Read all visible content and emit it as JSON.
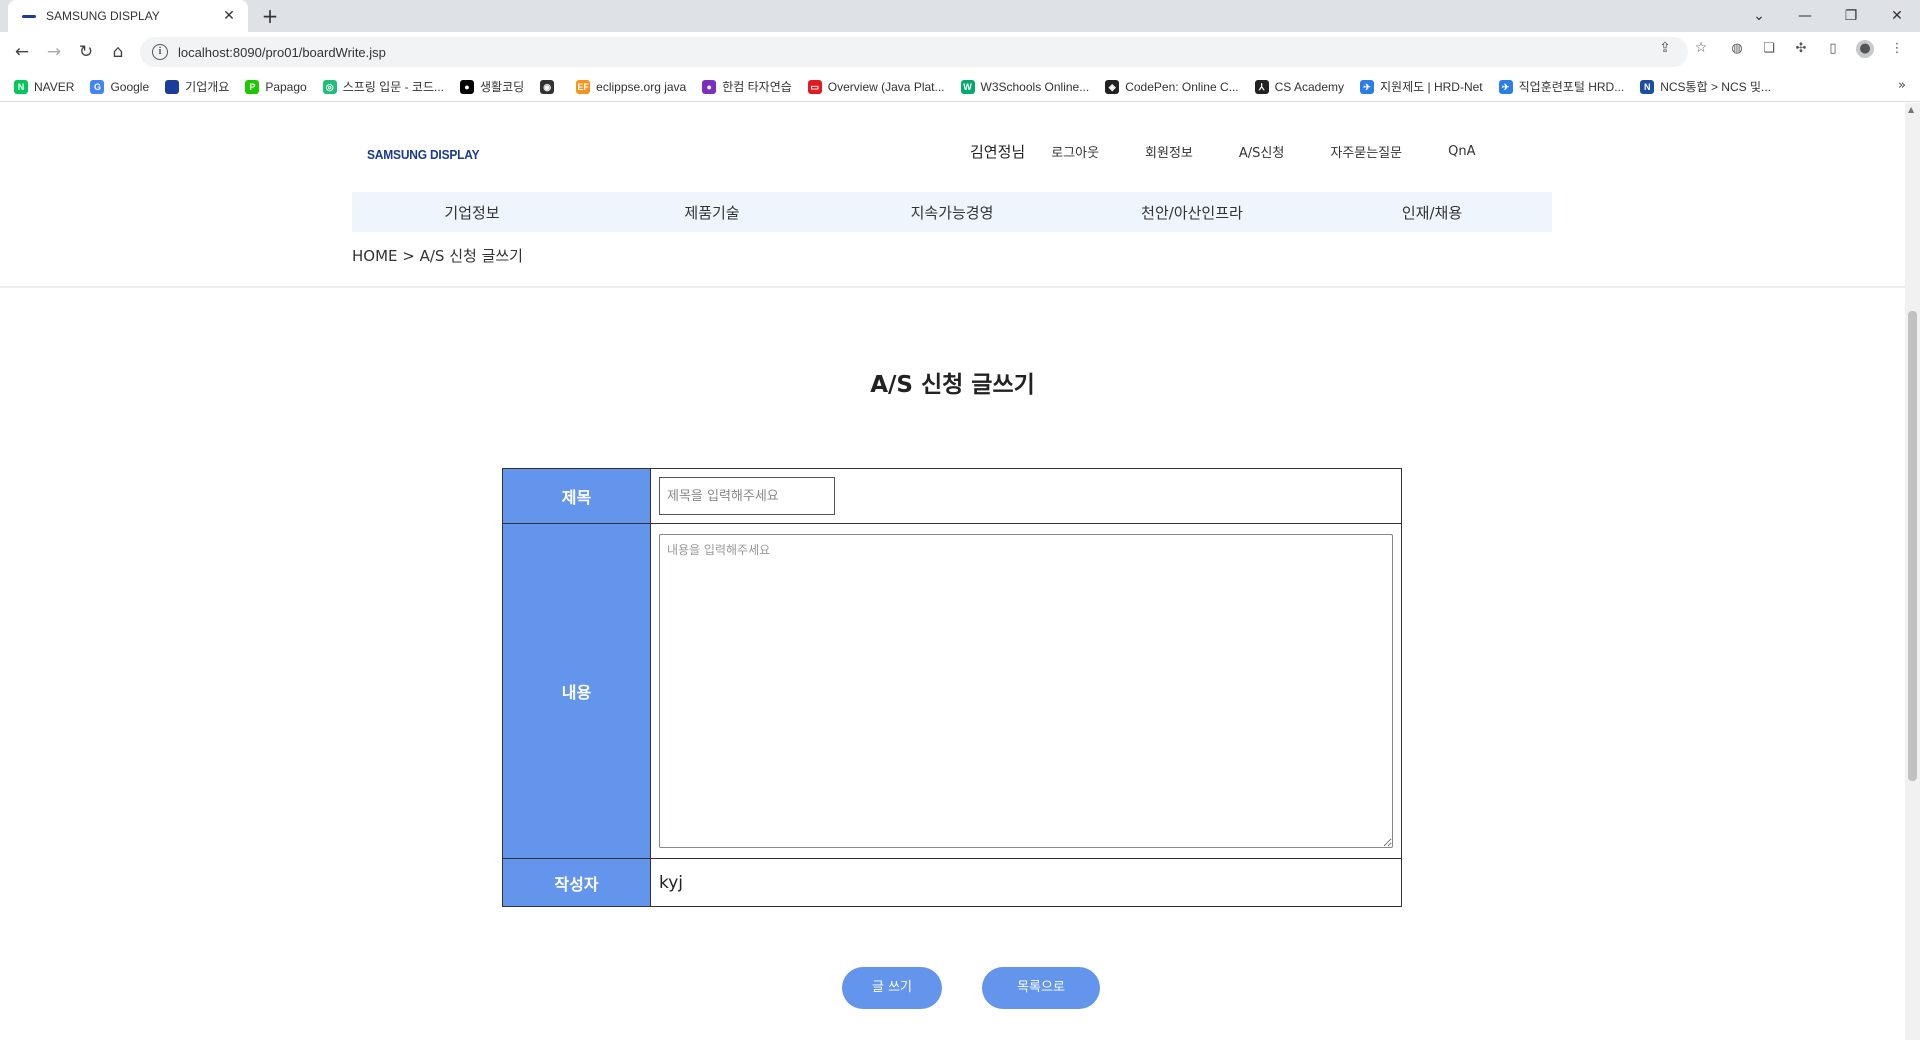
{
  "browser": {
    "tab_title": "SAMSUNG DISPLAY",
    "url": "localhost:8090/pro01/boardWrite.jsp",
    "bookmarks": [
      {
        "label": "NAVER",
        "icon": "naver-icon",
        "color": "#03c75a",
        "glyph": "N"
      },
      {
        "label": "Google",
        "icon": "google-icon",
        "color": "#4285f4",
        "glyph": "G"
      },
      {
        "label": "기업개요",
        "icon": "samsung-icon",
        "color": "#1c3c9b",
        "glyph": ""
      },
      {
        "label": "Papago",
        "icon": "papago-icon",
        "color": "#1ec800",
        "glyph": "P"
      },
      {
        "label": "스프링 입문 - 코드...",
        "icon": "inflearn-icon",
        "color": "#1dc078",
        "glyph": "◎"
      },
      {
        "label": "생활코딩",
        "icon": "opentutorials-icon",
        "color": "#000000",
        "glyph": "●"
      },
      {
        "label": "",
        "icon": "globe-icon",
        "color": "#333333",
        "glyph": "◉"
      },
      {
        "label": "eclippse.org java",
        "icon": "eclipse-icon",
        "color": "#f7941e",
        "glyph": "EF"
      },
      {
        "label": "한컴 타자연습",
        "icon": "hancom-icon",
        "color": "#7b2fbe",
        "glyph": "●"
      },
      {
        "label": "Overview (Java Plat...",
        "icon": "oracle-icon",
        "color": "#e11b22",
        "glyph": "▭"
      },
      {
        "label": "W3Schools Online...",
        "icon": "w3schools-icon",
        "color": "#04aa6d",
        "glyph": "W"
      },
      {
        "label": "CodePen: Online C...",
        "icon": "codepen-icon",
        "color": "#222222",
        "glyph": "◈"
      },
      {
        "label": "CS Academy",
        "icon": "csacademy-icon",
        "color": "#222222",
        "glyph": "⅄"
      },
      {
        "label": "지원제도 | HRD-Net",
        "icon": "hrdnet-icon",
        "color": "#2b7de9",
        "glyph": "✈"
      },
      {
        "label": "직업훈련포털 HRD...",
        "icon": "hrdnet-icon",
        "color": "#2b7de9",
        "glyph": "✈"
      },
      {
        "label": "NCS통합 > NCS 및...",
        "icon": "ncs-icon",
        "color": "#1b4ea0",
        "glyph": "N"
      }
    ]
  },
  "site": {
    "logo": "SAMSUNG DISPLAY",
    "user_name": "김연정님",
    "util_links": [
      "로그아웃",
      "회원정보",
      "A/S신청",
      "자주묻는질문",
      "QnA"
    ],
    "main_menu": [
      "기업정보",
      "제품기술",
      "지속가능경영",
      "천안/아산인프라",
      "인재/채용"
    ],
    "breadcrumb": "HOME > A/S 신청 글쓰기"
  },
  "form": {
    "page_title": "A/S 신청 글쓰기",
    "subject_label": "제목",
    "subject_placeholder": "제목을 입력해주세요",
    "content_label": "내용",
    "content_placeholder": "내용을 입력해주세요",
    "writer_label": "작성자",
    "writer_value": "kyj",
    "submit_label": "글 쓰기",
    "list_label": "목록으로"
  },
  "colors": {
    "accent": "#6495ed",
    "menu_bg": "#eef5fc",
    "logo": "#1b3a8c"
  }
}
